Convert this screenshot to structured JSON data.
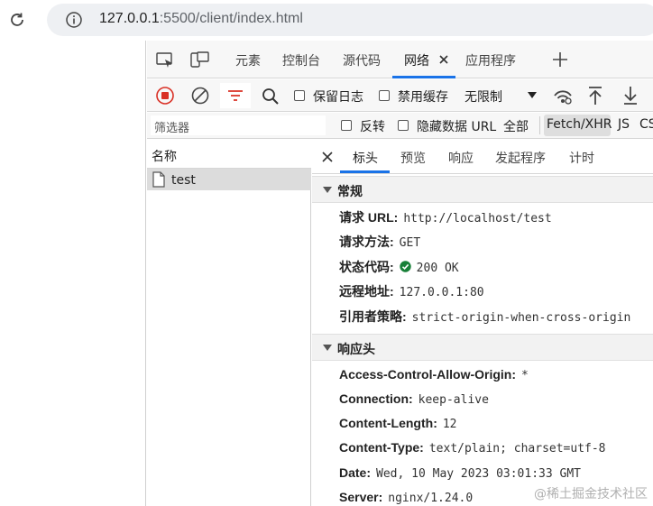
{
  "browser": {
    "url_host": "127.0.0.1",
    "url_rest": ":5500/client/index.html"
  },
  "devtools": {
    "tabs": [
      "元素",
      "控制台",
      "源代码",
      "网络",
      "应用程序"
    ],
    "toolbar": {
      "preserve_log": "保留日志",
      "disable_cache": "禁用缓存",
      "throttle": "无限制"
    },
    "filterbar": {
      "filter_placeholder": "筛选器",
      "invert": "反转",
      "hide_data_urls": "隐藏数据 URL",
      "all": "全部",
      "fetch_xhr": "Fetch/XHR",
      "js": "JS",
      "css": "CSS"
    },
    "request_list": {
      "header": "名称",
      "rows": [
        "test"
      ]
    },
    "details": {
      "tabs": [
        "标头",
        "预览",
        "响应",
        "发起程序",
        "计时"
      ],
      "general": {
        "title": "常规",
        "rows": [
          {
            "key": "请求 URL:",
            "value": "http://localhost/test"
          },
          {
            "key": "请求方法:",
            "value": "GET"
          },
          {
            "key": "状态代码:",
            "value": "200 OK"
          },
          {
            "key": "远程地址:",
            "value": "127.0.0.1:80"
          },
          {
            "key": "引用者策略:",
            "value": "strict-origin-when-cross-origin"
          }
        ]
      },
      "response_headers": {
        "title": "响应头",
        "rows": [
          {
            "key": "Access-Control-Allow-Origin:",
            "value": "*"
          },
          {
            "key": "Connection:",
            "value": "keep-alive"
          },
          {
            "key": "Content-Length:",
            "value": "12"
          },
          {
            "key": "Content-Type:",
            "value": "text/plain; charset=utf-8"
          },
          {
            "key": "Date:",
            "value": "Wed, 10 May 2023 03:01:33 GMT"
          },
          {
            "key": "Server:",
            "value": "nginx/1.24.0"
          }
        ]
      }
    }
  },
  "watermark": "@稀土掘金技术社区",
  "colors": {
    "accent": "#1a73e8",
    "record_red": "#d93025",
    "status_green": "#188038"
  }
}
